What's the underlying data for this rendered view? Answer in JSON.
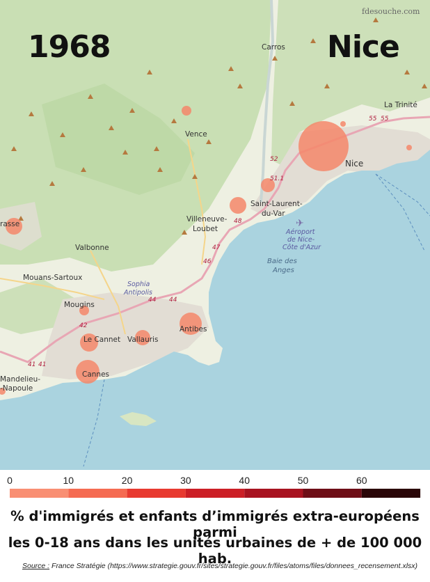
{
  "title": {
    "year": "1968",
    "city": "Nice"
  },
  "watermark": "fdesouche.com",
  "map": {
    "places": [
      {
        "name": "Carros",
        "icon": "place-label"
      },
      {
        "name": "La Trinité",
        "icon": "place-label"
      },
      {
        "name": "Vence",
        "icon": "place-label"
      },
      {
        "name": "Nice",
        "icon": "place-label"
      },
      {
        "name": "Saint-Laurent-",
        "name2": "du-Var",
        "icon": "place-label"
      },
      {
        "name": "Villeneuve-",
        "name2": "Loubet",
        "icon": "place-label"
      },
      {
        "name": "Valbonne",
        "icon": "place-label"
      },
      {
        "name": "Mouans-Sartoux",
        "icon": "place-label"
      },
      {
        "name": "Mougins",
        "icon": "place-label"
      },
      {
        "name": "Le Cannet",
        "icon": "place-label"
      },
      {
        "name": "Vallauris",
        "icon": "place-label"
      },
      {
        "name": "Antibes",
        "icon": "place-label"
      },
      {
        "name": "Cannes",
        "icon": "place-label"
      },
      {
        "name": "Mandelieu-",
        "name2": "-Napoule",
        "icon": "place-label"
      },
      {
        "name": "rasse",
        "icon": "place-label"
      }
    ],
    "special_labels": {
      "sophia_1": "Sophia",
      "sophia_2": "Antipolis",
      "airport_1": "Aéroport",
      "airport_2": "de Nice-",
      "airport_3": "Côte d'Azur",
      "bay_1": "Baie des",
      "bay_2": "Anges"
    },
    "road_numbers": [
      "52",
      "51.1",
      "55",
      "55",
      "48",
      "47",
      "46",
      "44",
      "44",
      "42",
      "41",
      "41"
    ],
    "circles": [
      {
        "place": "Nice",
        "icon": "proportional-circle"
      },
      {
        "place": "Saint-Laurent-du-Var",
        "icon": "proportional-circle"
      },
      {
        "place": "Villeneuve-Loubet",
        "icon": "proportional-circle"
      },
      {
        "place": "Vence",
        "icon": "proportional-circle"
      },
      {
        "place": "Antibes",
        "icon": "proportional-circle"
      },
      {
        "place": "Cannes",
        "icon": "proportional-circle"
      },
      {
        "place": "Le Cannet",
        "icon": "proportional-circle"
      },
      {
        "place": "Vallauris",
        "icon": "proportional-circle"
      },
      {
        "place": "Mougins",
        "icon": "proportional-circle"
      },
      {
        "place": "Grasse",
        "icon": "proportional-circle"
      },
      {
        "place": "La Trinité",
        "icon": "proportional-circle"
      },
      {
        "place": "Mandelieu",
        "icon": "proportional-circle"
      }
    ],
    "colors": {
      "sea": "#aad3df",
      "land": "#f1efe6",
      "forest": "#add19e",
      "urban": "#e0dcd3",
      "circle": "#f4876a"
    }
  },
  "scale": {
    "ticks": [
      "0",
      "10",
      "20",
      "30",
      "40",
      "50",
      "60"
    ],
    "colors": [
      "#f98f73",
      "#f56b52",
      "#e83a30",
      "#cc1f26",
      "#a81320",
      "#6e0e17",
      "#2a0608",
      "#000000"
    ]
  },
  "caption": {
    "line1": "% d'immigrés et enfants d’immigrés extra-européens parmi",
    "line2": "les 0-18 ans dans les unités urbaines de + de 100 000 hab."
  },
  "source": {
    "label": "Source :",
    "text": " France Stratégie (https://www.strategie.gouv.fr/sites/strategie.gouv.fr/files/atoms/files/donnees_recensement.xlsx)"
  }
}
